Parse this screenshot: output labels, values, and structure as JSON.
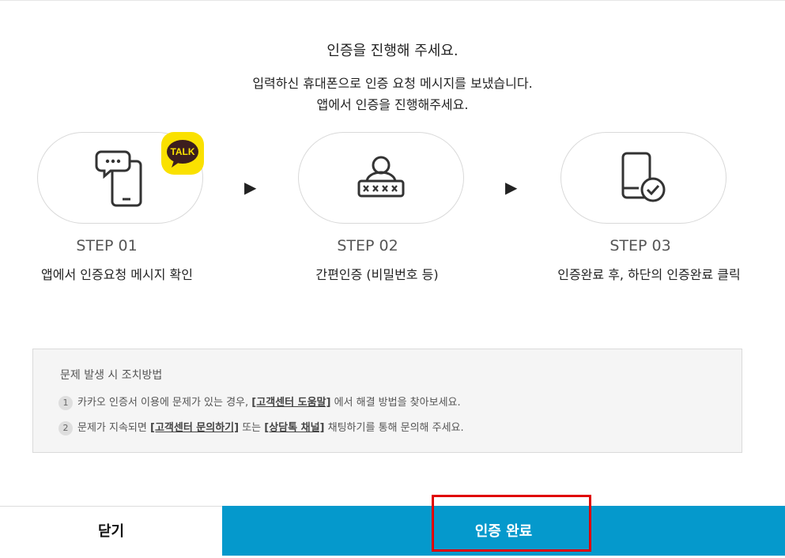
{
  "header": {
    "title": "인증을 진행해 주세요.",
    "line1": "입력하신 휴대폰으로 인증 요청 메시지를 보냈습니다.",
    "line2": "앱에서 인증을 진행해주세요."
  },
  "steps": [
    {
      "step": "STEP 01",
      "desc": "앱에서 인증요청 메시지 확인",
      "icon": "phone-chat-icon"
    },
    {
      "step": "STEP 02",
      "desc": "간편인증 (비밀번호 등)",
      "icon": "user-password-icon"
    },
    {
      "step": "STEP 03",
      "desc": "인증완료 후, 하단의 인증완료 클릭",
      "icon": "phone-check-icon"
    }
  ],
  "badge": {
    "text": "TALK",
    "color": "#fae100"
  },
  "arrow_glyph": "▶",
  "guide": {
    "title": "문제 발생 시 조치방법",
    "items": [
      {
        "num": "1",
        "pre": "카카오 인증서 이용에 문제가 있는 경우, ",
        "link": "[고객센터 도움말]",
        "post": " 에서 해결 방법을 찾아보세요."
      },
      {
        "num": "2",
        "pre": "문제가 지속되면 ",
        "link1": "[고객센터 문의하기]",
        "mid": " 또는 ",
        "link2": "[상담톡 채널]",
        "post": " 채팅하기를 통해 문의해 주세요."
      }
    ]
  },
  "buttons": {
    "close": "닫기",
    "done": "인증 완료"
  },
  "colors": {
    "primary": "#0599cc",
    "highlight": "#e00000"
  }
}
